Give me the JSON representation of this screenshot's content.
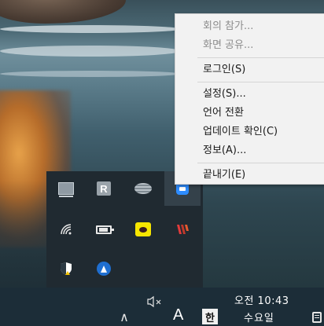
{
  "context_menu": {
    "items": [
      {
        "label": "회의 참가...",
        "enabled": false
      },
      {
        "label": "화면 공유...",
        "enabled": false
      },
      {
        "label": "로그인(S)",
        "enabled": true
      },
      {
        "label": "설정(S)...",
        "enabled": true
      },
      {
        "label": "언어 전환",
        "enabled": true
      },
      {
        "label": "업데이트 확인(C)",
        "enabled": true
      },
      {
        "label": "정보(A)...",
        "enabled": true
      },
      {
        "label": "끝내기(E)",
        "enabled": true
      }
    ]
  },
  "tray_flyout": {
    "icons": [
      {
        "name": "monitor-icon"
      },
      {
        "name": "r-app-icon"
      },
      {
        "name": "disk-icon"
      },
      {
        "name": "zoom-icon"
      },
      {
        "name": "wifi-icon"
      },
      {
        "name": "battery-icon"
      },
      {
        "name": "kakaotalk-icon"
      },
      {
        "name": "stripes-app-icon"
      },
      {
        "name": "security-shield-icon"
      },
      {
        "name": "navigation-icon"
      }
    ]
  },
  "taskbar": {
    "ime_mode": "A",
    "ime_lang": "한",
    "time": "오전 10:43",
    "day": "수요일"
  },
  "colors": {
    "menu_bg": "#f2f2f2",
    "flyout_bg": "#202a31",
    "taskbar_bg": "#1c2d38",
    "zoom_blue": "#2d8cff"
  }
}
